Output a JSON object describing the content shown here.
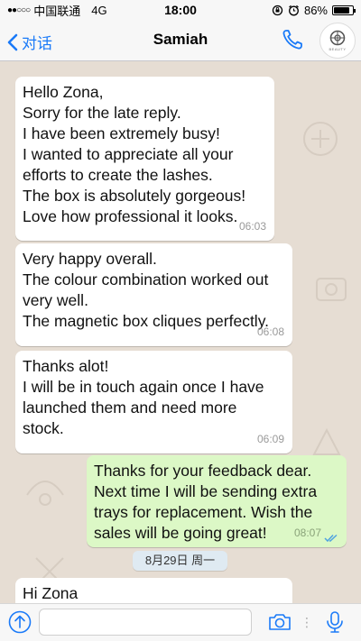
{
  "status_bar": {
    "signal": "●●○○○",
    "carrier": "中国联通",
    "network": "4G",
    "time": "18:00",
    "battery_percent": "86%",
    "battery_level": 0.86
  },
  "header": {
    "back_label": "对话",
    "contact_name": "Samiah",
    "avatar_text": "BEAUTY"
  },
  "messages": [
    {
      "direction": "incoming",
      "lines": [
        "Hello Zona,",
        "Sorry for the late reply.",
        "I have been extremely busy!",
        "I wanted to appreciate all your",
        "efforts to create the lashes.",
        "The box is absolutely gorgeous!",
        "Love how professional it looks."
      ],
      "time": "06:03"
    },
    {
      "direction": "incoming",
      "lines": [
        "Very happy overall.",
        "The colour combination worked out",
        "very well.",
        "The magnetic box cliques perfectly."
      ],
      "time": "06:08"
    },
    {
      "direction": "incoming",
      "lines": [
        "Thanks alot!",
        "I will be in touch again once I have",
        "launched them and need more",
        "stock."
      ],
      "time": "06:09"
    },
    {
      "direction": "outgoing",
      "lines": [
        "Thanks for your feedback dear.",
        "Next time I will be sending extra",
        "trays for replacement. Wish the",
        "sales will be going great!"
      ],
      "time": "08:07",
      "status": "read"
    },
    {
      "direction": "incoming",
      "lines": [
        "Hi Zona"
      ],
      "time": ""
    }
  ],
  "date_divider": "8月29日 周一",
  "input": {
    "value": "",
    "placeholder": ""
  },
  "colors": {
    "accent": "#1a7af8",
    "outgoing_bubble": "#dcf8c6",
    "incoming_bubble": "#ffffff",
    "chat_background": "#e6ddd3"
  }
}
